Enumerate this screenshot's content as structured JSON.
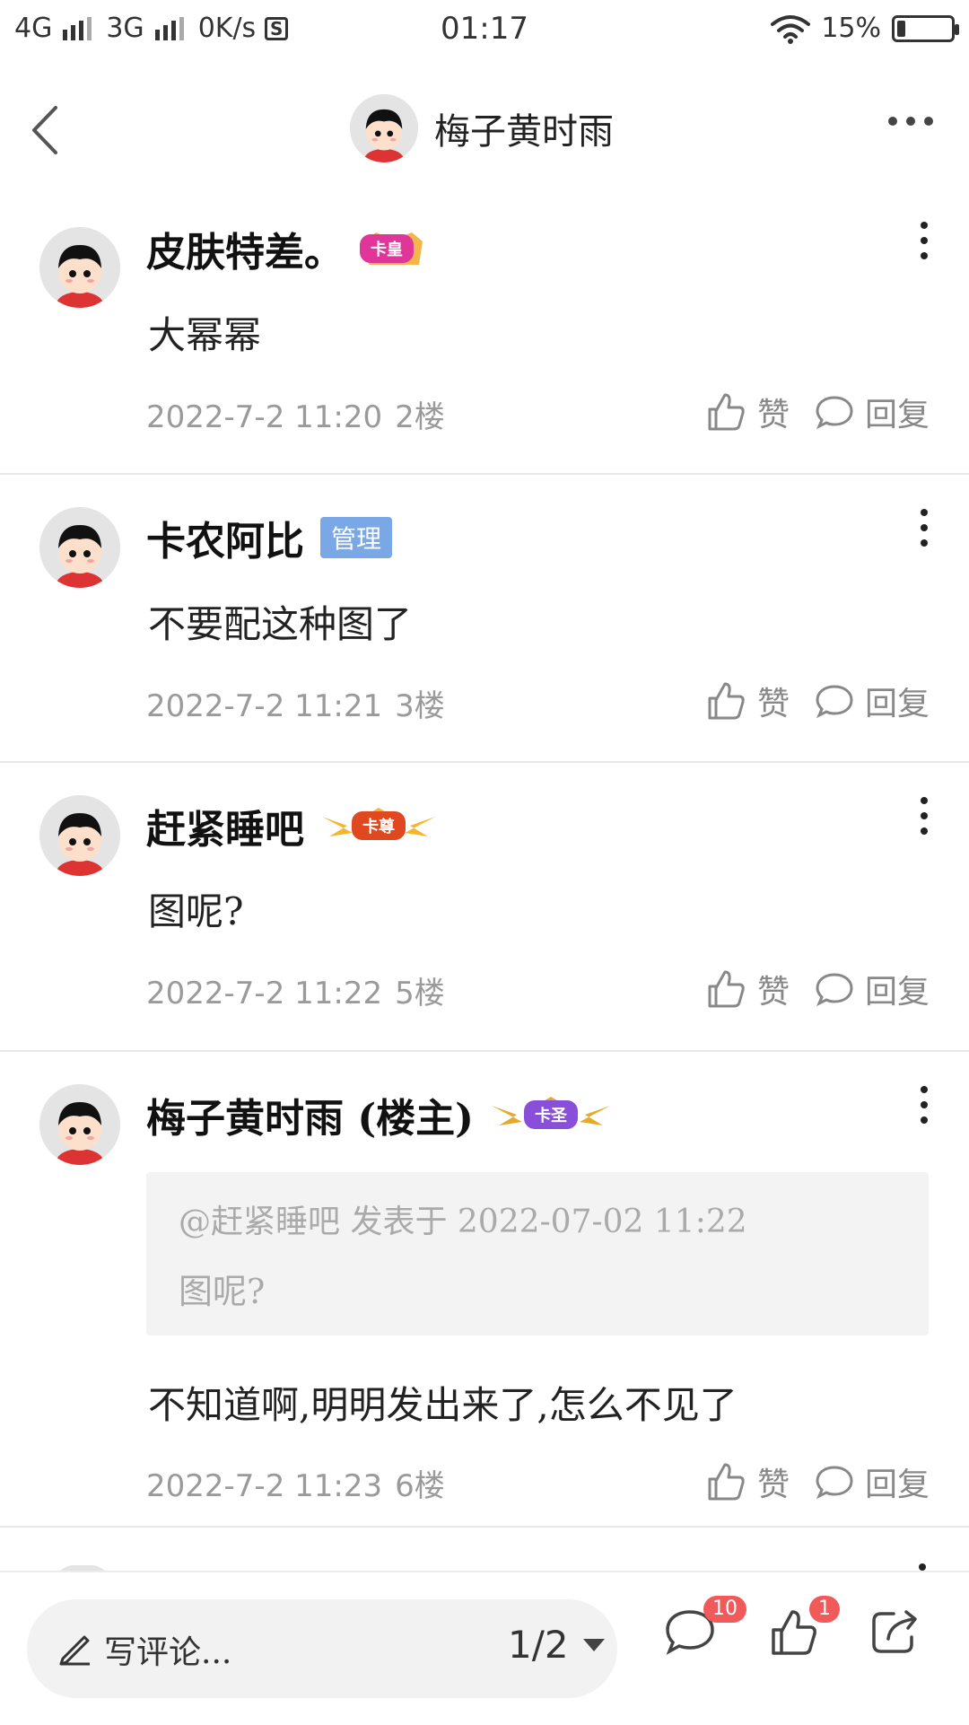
{
  "status_bar": {
    "net1": "4G",
    "net2": "3G",
    "speed": "0K/s",
    "s_icon": "S",
    "time": "01:17",
    "battery": "15%",
    "battery_level": 0.15
  },
  "header": {
    "title": "梅子黄时雨"
  },
  "comments": [
    {
      "user": "皮肤特差。",
      "badge_type": "crown",
      "badge_text": "卡皇",
      "content": "大幂幂",
      "date": "2022-7-2 11:20",
      "floor": "2楼",
      "like_label": "赞",
      "reply_label": "回复"
    },
    {
      "user": "卡农阿比",
      "badge_type": "admin",
      "badge_text": "管理",
      "content": "不要配这种图了",
      "date": "2022-7-2 11:21",
      "floor": "3楼",
      "like_label": "赞",
      "reply_label": "回复"
    },
    {
      "user": "赶紧睡吧",
      "badge_type": "crown",
      "badge_text": "卡尊",
      "content": "图呢?",
      "date": "2022-7-2 11:22",
      "floor": "5楼",
      "like_label": "赞",
      "reply_label": "回复"
    },
    {
      "user": "梅子黄时雨 (楼主)",
      "badge_type": "crown",
      "badge_text": "卡圣",
      "quote_line1": "@赶紧睡吧 发表于 2022-07-02 11:22",
      "quote_line2": "图呢?",
      "content": "不知道啊,明明发出来了,怎么不见了",
      "date": "2022-7-2 11:23",
      "floor": "6楼",
      "like_label": "赞",
      "reply_label": "回复"
    }
  ],
  "bottom_bar": {
    "write_placeholder": "写评论...",
    "page_indicator": "1/2",
    "comment_count": "10",
    "like_count": "1"
  },
  "colors": {
    "admin_badge": "#7aa8e6",
    "count_badge": "#f15a5a",
    "meta_text": "#9a9a9a"
  }
}
